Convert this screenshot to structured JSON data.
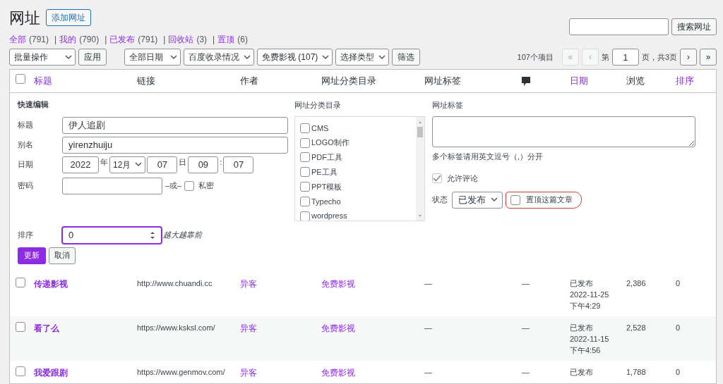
{
  "page_title": "网址",
  "add_button": "添加网址",
  "views": [
    {
      "label": "全部",
      "count": "(791)"
    },
    {
      "separator": "|",
      "label": "我的",
      "count": "(790)"
    },
    {
      "separator": "|",
      "label": "已发布",
      "count": "(791)"
    },
    {
      "separator": "|",
      "label": "回收站",
      "count": "(3)"
    },
    {
      "separator": "|",
      "label": "置顶",
      "count": "(6)"
    }
  ],
  "search": {
    "button": "搜索网址"
  },
  "bulk_actions": {
    "value": "批量操作",
    "apply": "应用"
  },
  "filters": [
    {
      "value": "全部日期"
    },
    {
      "value": "百度收录情况"
    },
    {
      "value": "免费影视 (107)"
    },
    {
      "value": "选择类型"
    }
  ],
  "filter_button": "筛选",
  "pagination": {
    "count": "107个项目",
    "before": "第",
    "page": "1",
    "after": "页，共3页",
    "nav": [
      {
        "label": "«",
        "disabled": true
      },
      {
        "label": "‹",
        "disabled": true
      },
      {
        "label": "›",
        "disabled": false
      },
      {
        "label": "»",
        "disabled": false
      }
    ]
  },
  "columns": [
    {
      "kind": "check",
      "checked": false
    },
    {
      "kind": "text",
      "label": "标题",
      "sortable": true
    },
    {
      "kind": "text",
      "label": "链接",
      "sortable": false
    },
    {
      "kind": "text",
      "label": "作者",
      "sortable": false
    },
    {
      "kind": "text",
      "label": "网址分类目录",
      "sortable": false
    },
    {
      "kind": "text",
      "label": "网址标签",
      "sortable": false
    },
    {
      "kind": "comment"
    },
    {
      "kind": "text",
      "label": "日期",
      "sortable": true
    },
    {
      "kind": "text",
      "label": "浏览",
      "sortable": false
    },
    {
      "kind": "text",
      "label": "排序",
      "sortable": true
    }
  ],
  "quick_edit": {
    "heading": "快速编辑",
    "fields": [
      {
        "label": "标题",
        "value": "伊人追剧"
      },
      {
        "label": "别名",
        "value": "yirenzhuiju"
      }
    ],
    "date": {
      "label": "日期",
      "year": "2022",
      "year_unit": "年",
      "month": "12月",
      "day": "07",
      "day_unit": "日",
      "hour": "09",
      "separator": ":",
      "minute": "07"
    },
    "password": {
      "label": "密码",
      "or": "–或–",
      "private_label": "私密",
      "private_checked": false
    },
    "order": {
      "label": "排序",
      "value": "0",
      "hint": "越大越靠前"
    },
    "update": "更新",
    "cancel": "取消",
    "categories_label": "网址分类目录",
    "categories": [
      {
        "label": "CMS",
        "checked": false
      },
      {
        "label": "LOGO制作",
        "checked": false
      },
      {
        "label": "PDF工具",
        "checked": false
      },
      {
        "label": "PE工具",
        "checked": false
      },
      {
        "label": "PPT模板",
        "checked": false
      },
      {
        "label": "Typecho",
        "checked": false
      },
      {
        "label": "wordpress",
        "checked": false
      }
    ],
    "tags_label": "网址标签",
    "tags_hint": "多个标签请用英文逗号（,）分开",
    "comments": {
      "label": "允许评论",
      "checked": true
    },
    "status": {
      "label": "状态",
      "value": "已发布"
    },
    "sticky": {
      "label": "置顶这篇文章",
      "checked": false,
      "highlighted": true
    }
  },
  "rows": [
    {
      "title": "传递影视",
      "link": "http://www.chuandi.cc",
      "author": "异客",
      "category": "免费影视",
      "tags": "—",
      "comments": "—",
      "date": [
        "已发布",
        "2022-11-25",
        "下午4:29"
      ],
      "views": "2,386",
      "order": "0",
      "checked": false
    },
    {
      "title": "看了么",
      "link": "https://www.ksksl.com/",
      "author": "异客",
      "category": "免费影视",
      "tags": "—",
      "comments": "—",
      "date": [
        "已发布",
        "2022-11-15",
        "下午4:56"
      ],
      "views": "2,528",
      "order": "0",
      "checked": false
    },
    {
      "title": "我爱跟剧",
      "link": "https://www.genmov.com/",
      "author": "异客",
      "category": "免费影视",
      "tags": "—",
      "comments": "—",
      "date": [
        "已发布"
      ],
      "views": "1,788",
      "order": "0",
      "checked": false
    }
  ]
}
